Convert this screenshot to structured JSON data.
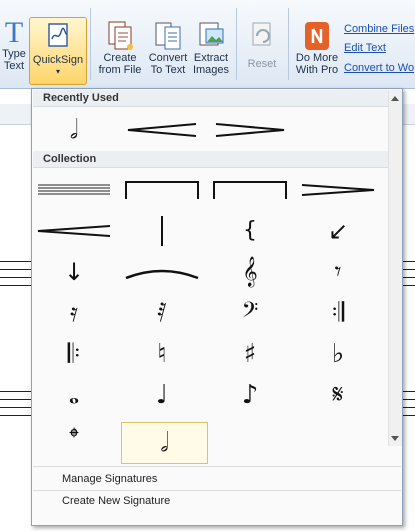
{
  "ribbon": {
    "type_text": [
      "Type",
      "Text"
    ],
    "quicksign": [
      "QuickSign",
      "▾"
    ],
    "create_from_file": [
      "Create",
      "from File"
    ],
    "convert_to_text": [
      "Convert",
      "To Text"
    ],
    "extract_images": [
      "Extract",
      "Images"
    ],
    "reset": "Reset",
    "do_more": [
      "Do More",
      "With Pro"
    ],
    "links": [
      "Combine Files",
      "Edit Text",
      "Convert to Wo"
    ]
  },
  "panel": {
    "recently_used_header": "Recently Used",
    "collection_header": "Collection",
    "recently_used": [
      "half-note",
      "crescendo-hairpin",
      "decrescendo-hairpin"
    ],
    "collection": [
      "staff-lines",
      "volta-bracket",
      "volta-bracket-2",
      "decrescendo-hairpin",
      "crescendo-hairpin",
      "barline",
      "brace",
      "arrow-down-left",
      "arrow-down",
      "slur",
      "treble-clef",
      "eighth-rest",
      "sixteenth-rest",
      "thirty-second-rest",
      "bass-clef",
      "end-repeat",
      "start-repeat",
      "natural",
      "sharp",
      "flat",
      "whole-note",
      "quarter-note",
      "eighth-note",
      "segno",
      "coda",
      "half-note"
    ],
    "menu": [
      "Manage Signatures",
      "Create New Signature"
    ]
  },
  "colors": {
    "accent": "#ffd56a",
    "link": "#1a4fb0",
    "panel_border": "#8ca1ba"
  }
}
